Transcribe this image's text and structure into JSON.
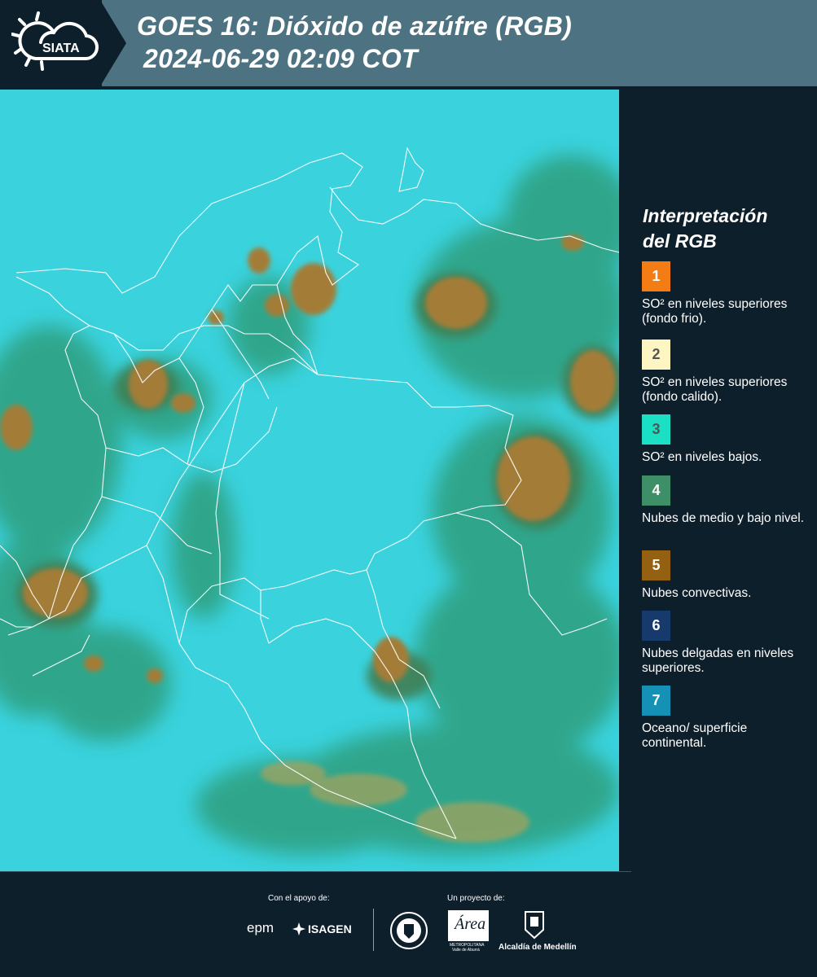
{
  "header": {
    "logo_text": "SIATA",
    "title_line1": "GOES 16: Dióxido de azúfre (RGB)",
    "title_line2": "2024-06-29 02:09 COT"
  },
  "legend": {
    "title_line1": "Interpretación",
    "title_line2": "del RGB",
    "items": [
      {
        "number": "1",
        "color": "#f47c14",
        "text": "SO² en niveles superiores (fondo frio)."
      },
      {
        "number": "2",
        "color": "#fdf6c3",
        "text": "SO² en niveles superiores (fondo calido)."
      },
      {
        "number": "3",
        "color": "#1be0c3",
        "text": "SO² en niveles bajos."
      },
      {
        "number": "4",
        "color": "#3e8f68",
        "text": "Nubes de medio y bajo nivel."
      },
      {
        "number": "5",
        "color": "#946012",
        "text": "Nubes convectivas."
      },
      {
        "number": "6",
        "color": "#153a6b",
        "text": "Nubes delgadas en niveles superiores."
      },
      {
        "number": "7",
        "color": "#1591b6",
        "text": "Oceano/ superficie continental."
      }
    ]
  },
  "footer": {
    "support_label": "Con el apoyo de:",
    "project_label": "Un proyecto de:",
    "sponsor_epm": "epm",
    "sponsor_isagen": "ISAGEN",
    "area_logo_text": "Área",
    "area_sub1": "METROPOLITANA",
    "area_sub2": "Valle de Aburrá",
    "alcaldia_text": "Alcaldía de Medellín"
  }
}
